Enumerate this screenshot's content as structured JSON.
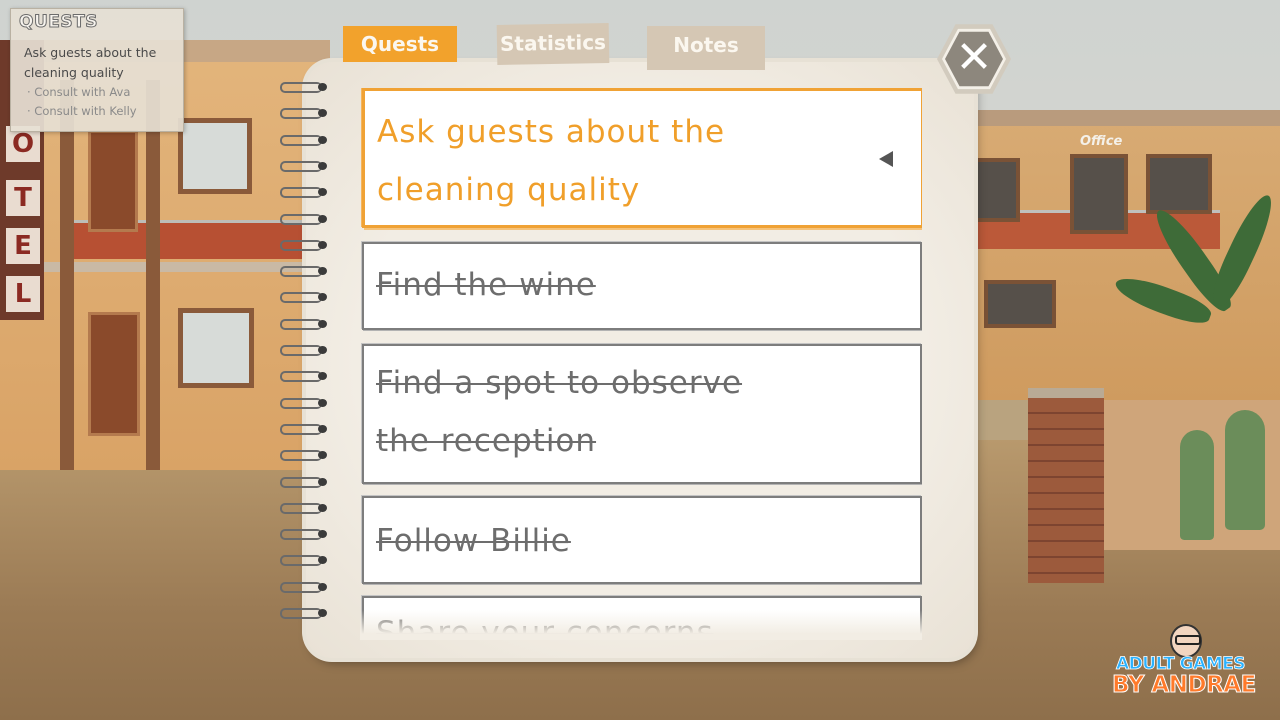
{
  "hud": {
    "title": "QUESTS",
    "line1": "Ask guests about the",
    "line2": "cleaning quality",
    "sub1": "· Consult with Ava",
    "sub2": "· Consult with Kelly"
  },
  "scene": {
    "sign_letters": [
      "O",
      "T",
      "E",
      "L"
    ],
    "office_sign": "Office"
  },
  "tabs": [
    {
      "label": "Quests",
      "active": true
    },
    {
      "label": "Statistics",
      "active": false
    },
    {
      "label": "Notes",
      "active": false
    }
  ],
  "close_button": {
    "icon": "close-icon"
  },
  "quests": [
    {
      "line1": "Ask guests about the",
      "line2": "cleaning quality",
      "status": "active"
    },
    {
      "line1": "Find the wine",
      "status": "completed"
    },
    {
      "line1": "Find a spot to observe",
      "line2": "the reception",
      "status": "completed"
    },
    {
      "line1": "Follow Billie",
      "status": "completed"
    },
    {
      "line1": "Share your concerns",
      "status": "completed"
    }
  ],
  "watermark": {
    "line1": "ADULT GAMES",
    "line2": "BY ANDRAE"
  },
  "colors": {
    "accent": "#f2a22c",
    "tab_inactive": "#d5c7b4",
    "completed_text": "#6d6d6d",
    "paper": "#f2ede4"
  }
}
